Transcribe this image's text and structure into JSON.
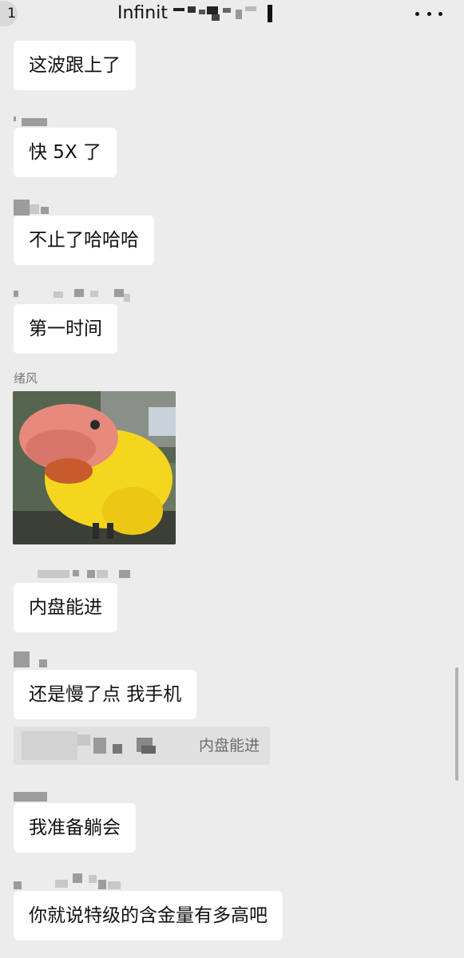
{
  "header": {
    "unread_count": "1",
    "title": "Infinit",
    "more_icon": "more-dots-icon"
  },
  "messages": [
    {
      "text": "这波跟上了"
    },
    {
      "text": "快 5X 了"
    },
    {
      "text": "不止了哈哈哈"
    },
    {
      "text": "第一时间"
    },
    {
      "sender": "绪风",
      "sticker": "yellow-parrot-sticker"
    },
    {
      "text": "内盘能进"
    },
    {
      "text": "还是慢了点 我手机",
      "quote": "内盘能进"
    },
    {
      "text": "我准备躺会"
    },
    {
      "text": "你就说特级的含金量有多高吧"
    }
  ],
  "colors": {
    "background": "#ececec",
    "bubble": "#ffffff",
    "quote": "#e0e0e0"
  }
}
